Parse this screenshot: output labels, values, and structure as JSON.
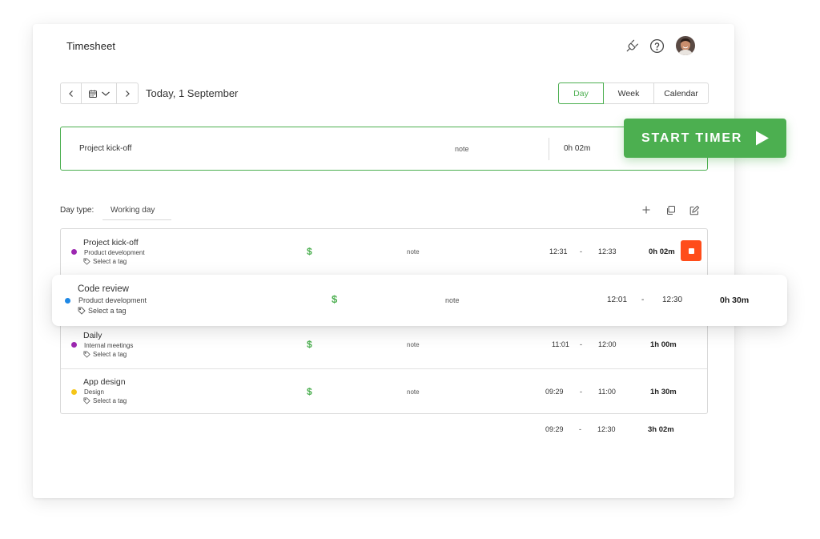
{
  "header": {
    "title": "Timesheet",
    "icons": [
      "plug-icon",
      "help-icon",
      "avatar"
    ]
  },
  "date_nav": {
    "label": "Today, 1 September"
  },
  "view_tabs": [
    {
      "label": "Day",
      "active": true
    },
    {
      "label": "Week",
      "active": false
    },
    {
      "label": "Calendar",
      "active": false
    }
  ],
  "timer": {
    "task": "Project kick-off",
    "note": "note",
    "duration": "0h 02m",
    "start_label": "START TIMER"
  },
  "day_type": {
    "label": "Day type:",
    "value": "Working day"
  },
  "entries": [
    {
      "title": "Project kick-off",
      "project": "Product development",
      "tag": "Select a tag",
      "dot_color": "#9c27b0",
      "note": "note",
      "start": "12:31",
      "sep": "-",
      "end": "12:33",
      "duration": "0h 02m",
      "running": true
    },
    {
      "title": "Code review",
      "project": "Product development",
      "tag": "Select a tag",
      "dot_color": "#1e88e5",
      "note": "note",
      "start": "12:01",
      "sep": "-",
      "end": "12:30",
      "duration": "0h 30m",
      "running": false
    },
    {
      "title": "Daily",
      "project": "Internal meetings",
      "tag": "Select a tag",
      "dot_color": "#9c27b0",
      "note": "note",
      "start": "11:01",
      "sep": "-",
      "end": "12:00",
      "duration": "1h 00m",
      "running": false
    },
    {
      "title": "App design",
      "project": "Design",
      "tag": "Select a tag",
      "dot_color": "#f5c518",
      "note": "note",
      "start": "09:29",
      "sep": "-",
      "end": "11:00",
      "duration": "1h 30m",
      "running": false
    }
  ],
  "totals": {
    "start": "09:29",
    "sep": "-",
    "end": "12:30",
    "duration": "3h 02m"
  },
  "colors": {
    "accent": "#4caf50",
    "stop": "#ff4d1a"
  }
}
